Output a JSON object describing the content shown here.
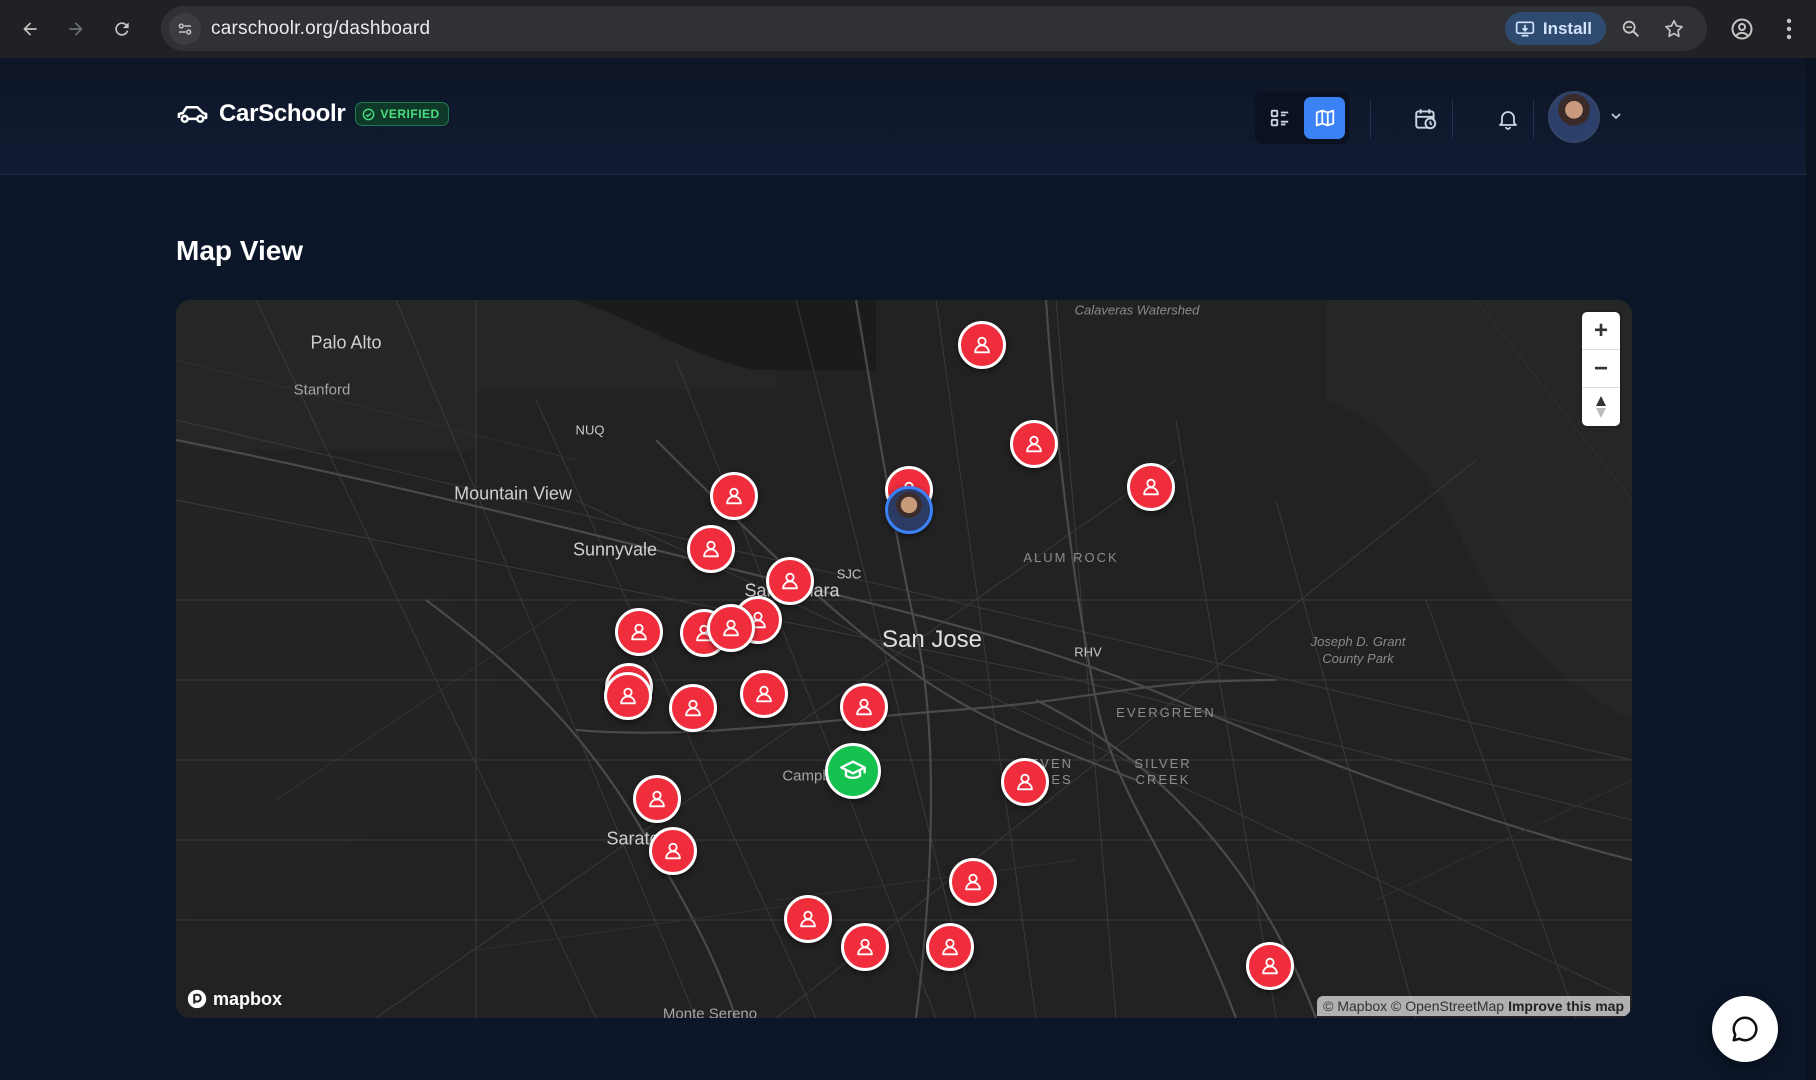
{
  "browser": {
    "url": "carschoolr.org/dashboard",
    "install_label": "Install"
  },
  "header": {
    "brand_name": "CarSchoolr",
    "verified_label": "VERIFIED"
  },
  "page": {
    "title": "Map View"
  },
  "map": {
    "labels": {
      "palo_alto": "Palo Alto",
      "stanford": "Stanford",
      "nuq": "NUQ",
      "mountain_view": "Mountain View",
      "sunnyvale": "Sunnyvale",
      "sjc": "SJC",
      "santa_clara": "Santa Clara",
      "san_jose": "San Jose",
      "alum_rock": "ALUM ROCK",
      "rhv": "RHV",
      "evergreen": "EVERGREEN",
      "seven_trees_1": "SEVEN",
      "seven_trees_2": "TREES",
      "silver_creek_1": "SILVER",
      "silver_creek_2": "CREEK",
      "campbell": "Campbell",
      "saratoga": "Saratoga",
      "monte_sereno": "Monte Sereno",
      "calaveras": "Calaveras Watershed",
      "grant_park_1": "Joseph D. Grant",
      "grant_park_2": "County Park"
    },
    "zoom_in": "+",
    "zoom_out": "−",
    "logo": "mapbox",
    "attribution": "© Mapbox © OpenStreetMap",
    "improve": "Improve this map"
  },
  "colors": {
    "student_marker": "#ef2d3c",
    "school_marker": "#16c24f",
    "accent": "#3b82f6",
    "verified": "#4ade80"
  }
}
